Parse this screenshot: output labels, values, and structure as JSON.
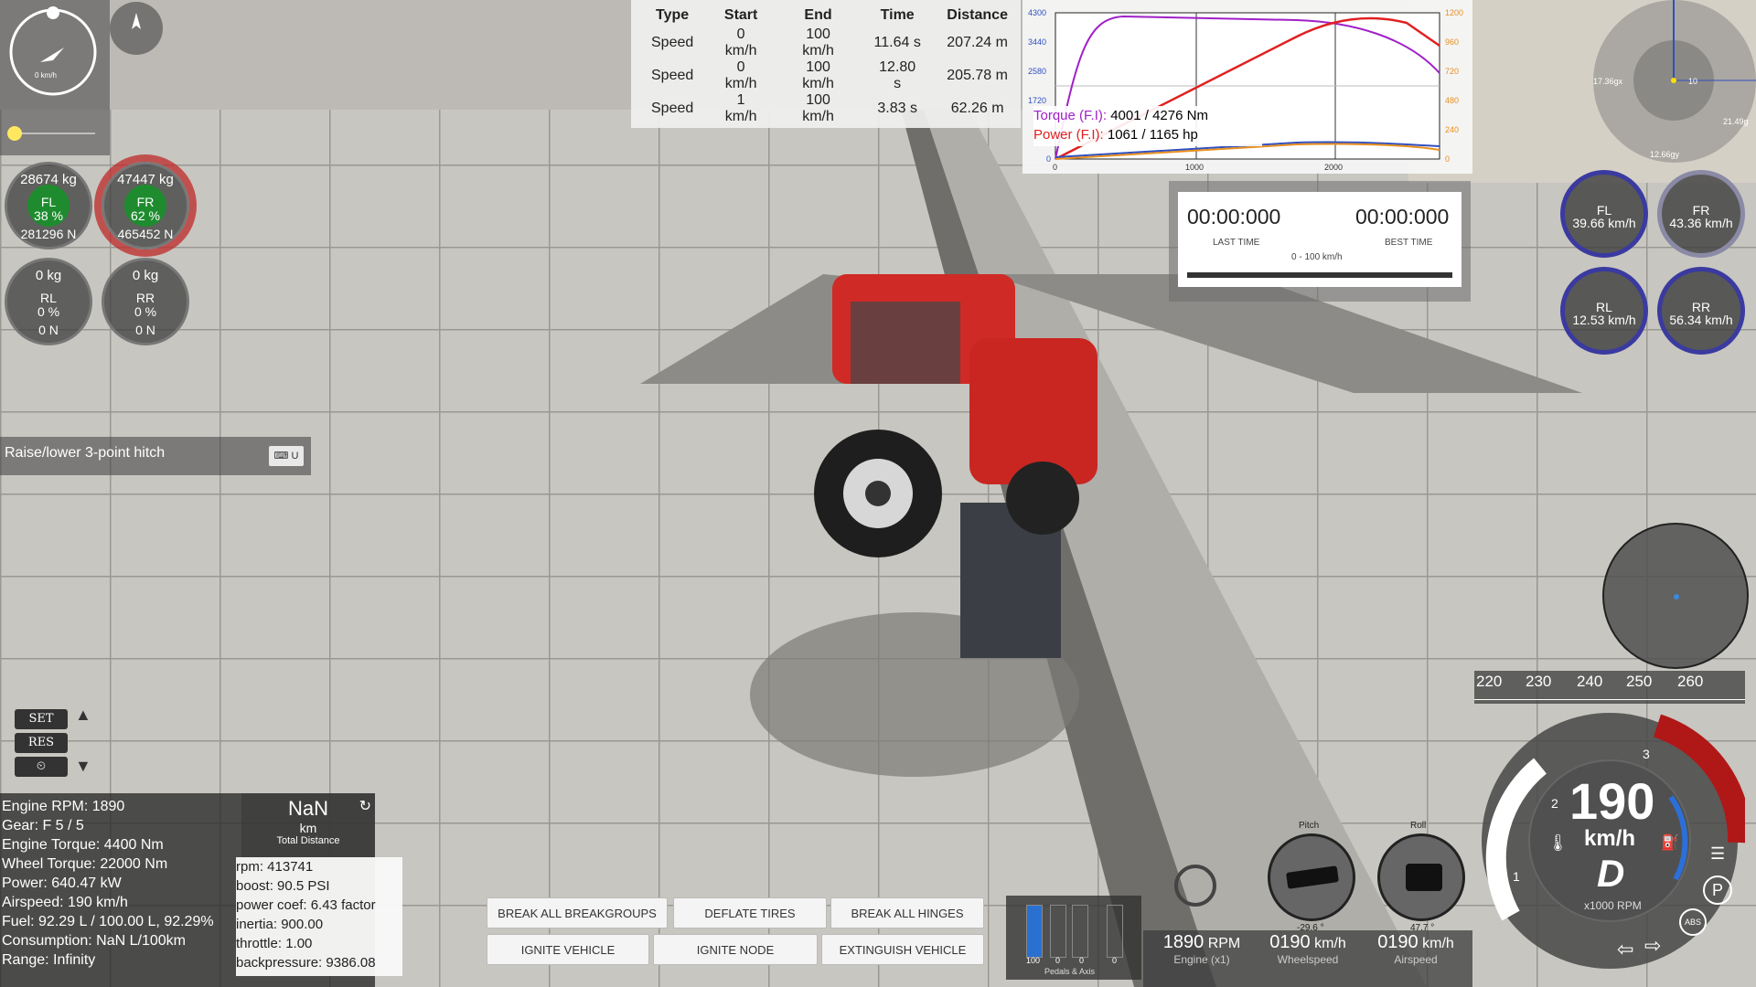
{
  "nav": {
    "speed_label": "0 km/h"
  },
  "wheels": {
    "fl": {
      "kg": "28674  kg",
      "name": "FL",
      "pct": "38 %",
      "n": "281296  N"
    },
    "fr": {
      "kg": "47447  kg",
      "name": "FR",
      "pct": "62 %",
      "n": "465452  N"
    },
    "rl": {
      "kg": "0  kg",
      "name": "RL",
      "pct": "0 %",
      "n": "0  N"
    },
    "rr": {
      "kg": "0  kg",
      "name": "RR",
      "pct": "0 %",
      "n": "0  N"
    }
  },
  "hint": {
    "text": "Raise/lower 3-point hitch",
    "key": "U"
  },
  "cruise": {
    "set": "SET",
    "res": "RES"
  },
  "stats": {
    "lines": [
      "Engine RPM: 1890",
      "Gear: F 5 / 5",
      "Engine Torque: 4400 Nm",
      "Wheel Torque: 22000 Nm",
      "Power: 640.47 kW",
      "Airspeed: 190 km/h",
      "Fuel: 92.29 L / 100.00 L, 92.29%",
      "Consumption: NaN L/100km",
      "Range: Infinity"
    ],
    "total_value": "NaN",
    "total_unit": "km",
    "total_label": "Total Distance",
    "engine": [
      "rpm: 413741",
      "boost: 90.5 PSI",
      "power coef: 6.43 factor",
      "inertia: 900.00",
      "throttle: 1.00",
      "backpressure: 9386.08"
    ]
  },
  "timing": {
    "headers": [
      "Type",
      "Start",
      "End",
      "Time",
      "Distance"
    ],
    "rows": [
      [
        "Speed",
        "0 km/h",
        "100 km/h",
        "11.64 s",
        "207.24 m"
      ],
      [
        "Speed",
        "0 km/h",
        "100 km/h",
        "12.80 s",
        "205.78 m"
      ],
      [
        "Speed",
        "1 km/h",
        "100 km/h",
        "3.83 s",
        "62.26 m"
      ]
    ]
  },
  "dyno": {
    "torque_label": "Torque (F.I):",
    "torque_value": "4001 / 4276 Nm",
    "power_label": "Power (F.I):",
    "power_value": "1061 / 1165 hp",
    "left_ticks": [
      "4300",
      "3440",
      "2580",
      "1720",
      "0"
    ],
    "right_ticks": [
      "1200",
      "960",
      "720",
      "480",
      "240",
      "0"
    ],
    "x_ticks": [
      "0",
      "1000",
      "2000"
    ],
    "colors": {
      "torque": "#a020c8",
      "power": "#e02020",
      "blue": "#3050c0",
      "orange": "#e89020"
    }
  },
  "laptimer": {
    "last": "00:00:000",
    "last_label": "LAST TIME",
    "best": "00:00:000",
    "best_label": "BEST TIME",
    "mode": "0 - 100 km/h"
  },
  "wheelspeeds": {
    "fl": {
      "name": "FL",
      "v": "39.66 km/h"
    },
    "fr": {
      "name": "FR",
      "v": "43.36 km/h"
    },
    "rl": {
      "name": "RL",
      "v": "12.53 km/h"
    },
    "rr": {
      "name": "RR",
      "v": "56.34 km/h"
    }
  },
  "gforce": {
    "x": "17.36gx",
    "y": "21.49g",
    "z": "12.66gy",
    "mid": "10"
  },
  "tape": {
    "ticks": [
      "220",
      "230",
      "240",
      "250",
      "260"
    ]
  },
  "speedo": {
    "speed": "190",
    "unit": "km/h",
    "gear": "D",
    "rpm_label": "x1000 RPM",
    "marks": [
      "1",
      "2",
      "3"
    ]
  },
  "buttons": {
    "break_groups": "BREAK ALL BREAKGROUPS",
    "deflate": "DEFLATE TIRES",
    "break_hinges": "BREAK ALL HINGES",
    "ignite_vehicle": "IGNITE VEHICLE",
    "ignite_node": "IGNITE NODE",
    "extinguish": "EXTINGUISH VEHICLE"
  },
  "pedals": {
    "values": [
      "100",
      "0",
      "0",
      "0"
    ],
    "label": "Pedals & Axis",
    "fill": 1.0
  },
  "readouts": {
    "rpm": {
      "v": "1890",
      "u": "RPM",
      "l": "Engine (x1)"
    },
    "wheel": {
      "v": "0190",
      "u": "km/h",
      "l": "Wheelspeed"
    },
    "air": {
      "v": "0190",
      "u": "km/h",
      "l": "Airspeed"
    }
  },
  "attitude": {
    "pitch_label": "Pitch",
    "pitch_val": "-29.6 °",
    "roll_label": "Roll",
    "roll_val": "47.7 °"
  }
}
